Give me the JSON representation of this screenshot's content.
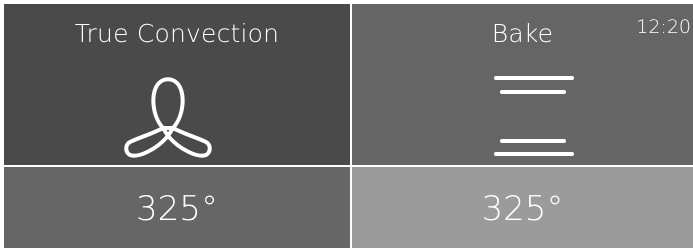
{
  "status": {
    "time": "12:20"
  },
  "modes": [
    {
      "label": "True Convection",
      "temperature": "325°",
      "icon": "fan-icon",
      "selected": true
    },
    {
      "label": "Bake",
      "temperature": "325°",
      "icon": "bake-elements-icon",
      "selected": false
    }
  ],
  "colors": {
    "mode_selected_bg": "#4a4a4a",
    "mode_unselected_bg": "#656565",
    "temp_selected_bg": "#666666",
    "temp_unselected_bg": "#9b9b9b",
    "divider": "#d0d0d0",
    "text": "#ffffff"
  }
}
